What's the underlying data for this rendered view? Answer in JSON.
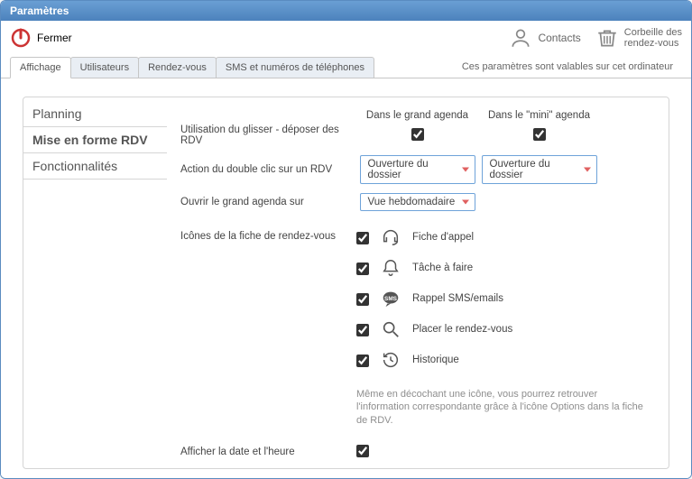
{
  "window": {
    "title": "Paramètres"
  },
  "toolbar": {
    "close": "Fermer",
    "contacts": "Contacts",
    "trash_l1": "Corbeille des",
    "trash_l2": "rendez-vous"
  },
  "tabs": {
    "t0": "Affichage",
    "t1": "Utilisateurs",
    "t2": "Rendez-vous",
    "t3": "SMS et numéros de téléphones",
    "caption": "Ces paramètres sont valables sur cet ordinateur"
  },
  "sidebar": {
    "i0": "Planning",
    "i1": "Mise en forme RDV",
    "i2": "Fonctionnalités"
  },
  "main": {
    "header": {
      "c1": "Dans le grand agenda",
      "c2": "Dans le \"mini\" agenda"
    },
    "r1_label": "Utilisation du glisser - déposer des RDV",
    "r2_label": "Action du double clic sur un RDV",
    "r3_label": "Ouvrir le grand agenda sur",
    "dd_open_folder": "Ouverture du dossier",
    "dd_week": "Vue hebdomadaire",
    "icons_label": "Icônes de la fiche de rendez-vous",
    "icons": {
      "i0": "Fiche d'appel",
      "i1": "Tâche à faire",
      "i2": "Rappel SMS/emails",
      "i3": "Placer le rendez-vous",
      "i4": "Historique"
    },
    "icons_hint": "Même en décochant une icône, vous pourrez retrouver l'information correspondante grâce à l'icône Options dans la fiche de RDV.",
    "last_label": "Afficher la date et l'heure"
  }
}
